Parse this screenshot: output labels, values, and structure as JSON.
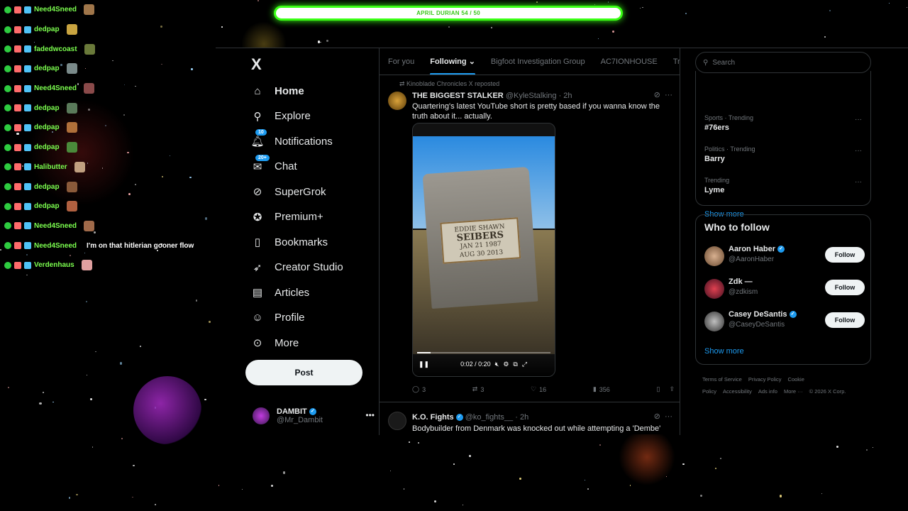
{
  "goal_bar": {
    "text": "APRIL DURIAN 54 / 50"
  },
  "chat": [
    {
      "user": "Need4Sneed",
      "message": ""
    },
    {
      "user": "dedpap",
      "message": ""
    },
    {
      "user": "fadedwcoast",
      "message": ""
    },
    {
      "user": "dedpap",
      "message": ""
    },
    {
      "user": "Need4Sneed",
      "message": ""
    },
    {
      "user": "dedpap",
      "message": ""
    },
    {
      "user": "dedpap",
      "message": ""
    },
    {
      "user": "dedpap",
      "message": ""
    },
    {
      "user": "Halibutter",
      "message": ""
    },
    {
      "user": "dedpap",
      "message": ""
    },
    {
      "user": "dedpap",
      "message": ""
    },
    {
      "user": "Need4Sneed",
      "message": ""
    },
    {
      "user": "Need4Sneed",
      "message": "I'm on that hitlerian gooner flow"
    },
    {
      "user": "Verdenhaus",
      "message": ""
    }
  ],
  "sidebar": {
    "logo": "X",
    "items": [
      {
        "label": "Home",
        "icon": "home-icon",
        "active": true
      },
      {
        "label": "Explore",
        "icon": "search-icon",
        "active": false
      },
      {
        "label": "Notifications",
        "icon": "bell-icon",
        "badge": "10"
      },
      {
        "label": "Chat",
        "icon": "chat-icon",
        "badge": "20+"
      },
      {
        "label": "SuperGrok",
        "icon": "grok-icon"
      },
      {
        "label": "Premium+",
        "icon": "premium-icon"
      },
      {
        "label": "Bookmarks",
        "icon": "bookmark-icon"
      },
      {
        "label": "Creator Studio",
        "icon": "rocket-icon"
      },
      {
        "label": "Articles",
        "icon": "article-icon"
      },
      {
        "label": "Profile",
        "icon": "profile-icon"
      },
      {
        "label": "More",
        "icon": "more-icon"
      }
    ],
    "post_label": "Post",
    "account": {
      "name": "DAMBIT",
      "handle": "@Mr_Dambit"
    }
  },
  "feed": {
    "tabs": [
      "For you",
      "Following",
      "Bigfoot Investigation Group",
      "AC7IONHOUSE",
      "Tr"
    ],
    "active_tab": "Following",
    "tweet1": {
      "repost": "Kinoblade Chronicles X reposted",
      "name": "THE BIGGEST STALKER",
      "handle": "@KyleStalking",
      "time": "· 2h",
      "text": "Quartering's latest YouTube short is pretty based if you wanna know the truth about it... actually.",
      "video": {
        "plaque_line1": "EDDIE SHAWN",
        "plaque_line2": "SEIBERS",
        "plaque_line3": "JAN 21 1987",
        "plaque_line4": "AUG 30 2013",
        "time": "0:02 / 0:20",
        "progress": 0.1
      },
      "metrics": {
        "replies": "3",
        "reposts": "3",
        "likes": "16",
        "views": "356"
      }
    },
    "tweet2": {
      "name": "K.O. Fights",
      "handle": "@ko_fights__",
      "time": "· 2h",
      "text": "Bodybuilder from Denmark was knocked out while attempting a 'Dembe'"
    }
  },
  "right": {
    "search_placeholder": "Search",
    "trends": [
      {
        "category": "Sports · Trending",
        "name": "#76ers"
      },
      {
        "category": "Politics · Trending",
        "name": "Barry"
      },
      {
        "category": "Trending",
        "name": "Lyme"
      }
    ],
    "show_more": "Show more",
    "who_to_follow": {
      "title": "Who to follow",
      "accounts": [
        {
          "name": "Aaron Haber",
          "handle": "@AaronHaber"
        },
        {
          "name": "Zdk —",
          "handle": "@zdkism"
        },
        {
          "name": "Casey DeSantis",
          "handle": "@CaseyDeSantis"
        }
      ],
      "follow_label": "Follow",
      "show_more": "Show more"
    },
    "footer": [
      "Terms of Service",
      "Privacy Policy",
      "Cookie Policy",
      "Accessibility",
      "Ads info",
      "More ···",
      "© 2026 X Corp."
    ]
  }
}
